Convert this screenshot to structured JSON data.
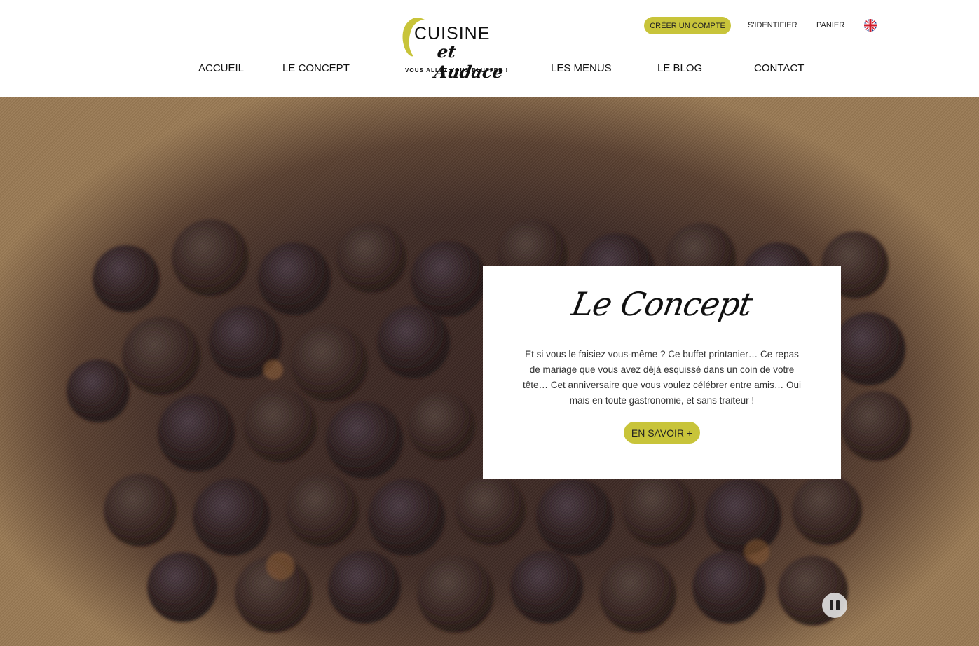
{
  "logo": {
    "title": "CUISINE",
    "script": "et Audace",
    "tagline": "VOUS ALLEZ VOUS BLUFFER !"
  },
  "nav": {
    "items": [
      {
        "label": "ACCUEIL",
        "active": true
      },
      {
        "label": "LE CONCEPT",
        "active": false
      },
      {
        "label": "LES MENUS",
        "active": false
      },
      {
        "label": "LE BLOG",
        "active": false
      },
      {
        "label": "CONTACT",
        "active": false
      }
    ]
  },
  "utility": {
    "create_account": "CRÉER UN COMPTE",
    "login": "S'IDENTIFIER",
    "cart": "PANIER",
    "language_icon": "uk-flag-icon"
  },
  "hero": {
    "card_title": "Le Concept",
    "card_text": "Et si vous le faisiez vous-même ? Ce buffet printanier… Ce repas de mariage que vous avez déjà esquissé dans un coin de votre tête… Cet anniversaire que vous voulez célébrer entre amis… Oui mais en toute gastronomie, et sans traiteur !",
    "cta": "EN SAVOIR +",
    "pause_icon": "pause-icon"
  },
  "colors": {
    "accent": "#c8c43a",
    "background": "#ffffff",
    "text": "#111111"
  }
}
